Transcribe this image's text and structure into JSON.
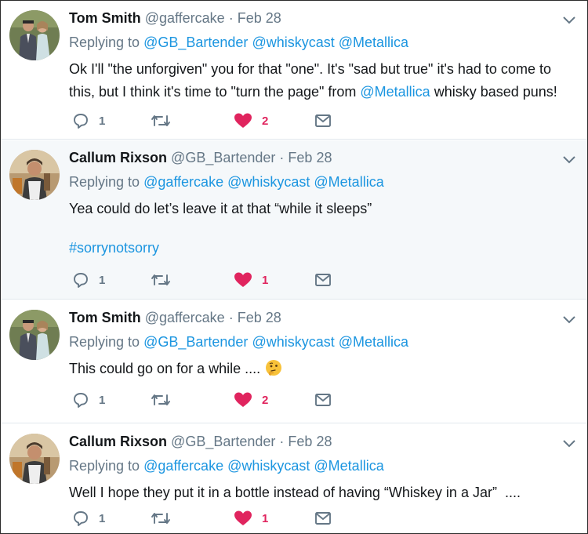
{
  "colors": {
    "like_red": "#e0245e",
    "link_blue": "#1b95e0",
    "muted_grey": "#657786",
    "highlight_bg": "#f5f8fa"
  },
  "icons": {
    "reply": "reply-icon",
    "retweet": "retweet-icon",
    "like": "heart-icon",
    "dm": "envelope-icon",
    "more": "chevron-down-icon"
  },
  "tweets": [
    {
      "name": "Tom Smith",
      "handle": "@gaffercake",
      "separator": "·",
      "date": "Feb 28",
      "replying_prefix": "Replying to",
      "replying_to": [
        "@GB_Bartender",
        "@whiskycast",
        "@Metallica"
      ],
      "text_before": "Ok I'll \"the unforgiven\" you for that \"one\". It's \"sad but true\" it's had to come to",
      "text_line2_before": "this, but I think it's time to \"turn the page\" from ",
      "text_line2_mention": "@Metallica",
      "text_line2_after": " whisky based puns!",
      "reply_count": "1",
      "like_count": "2"
    },
    {
      "name": "Callum Rixson",
      "handle": "@GB_Bartender",
      "separator": "·",
      "date": "Feb 28",
      "replying_prefix": "Replying to",
      "replying_to": [
        "@gaffercake",
        "@whiskycast",
        "@Metallica"
      ],
      "text": "Yea could do let’s leave it at that “while it sleeps”",
      "hashtag": "#sorrynotsorry",
      "reply_count": "1",
      "like_count": "1"
    },
    {
      "name": "Tom Smith",
      "handle": "@gaffercake",
      "separator": "·",
      "date": "Feb 28",
      "replying_prefix": "Replying to",
      "replying_to": [
        "@GB_Bartender",
        "@whiskycast",
        "@Metallica"
      ],
      "text": "This could go on for a while ....",
      "emoji": "thinking-face-emoji",
      "reply_count": "1",
      "like_count": "2"
    },
    {
      "name": "Callum Rixson",
      "handle": "@GB_Bartender",
      "separator": "·",
      "date": "Feb 28",
      "replying_prefix": "Replying to",
      "replying_to": [
        "@gaffercake",
        "@whiskycast",
        "@Metallica"
      ],
      "text": "Well I hope they put it in a bottle instead of having “Whiskey in a Jar”  ....",
      "reply_count": "1",
      "like_count": "1"
    }
  ]
}
